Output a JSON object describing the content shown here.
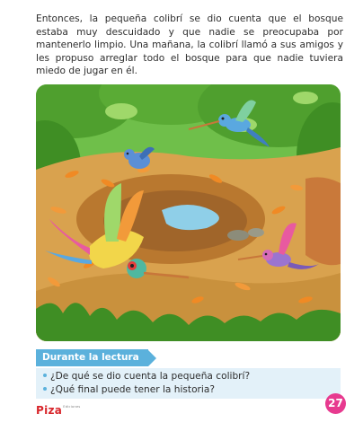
{
  "story": {
    "paragraph": "Entonces, la pequeña colibrí se dio cuenta que el bosque estaba muy descuidado y que nadie se preocupaba por mantenerlo limpio. Una mañana, la colibrí llamó a sus amigos y les propuso arreglar todo el bosque para que nadie tuviera miedo de jugar en él."
  },
  "illustration": {
    "palette": {
      "sky": "#6fbf4a",
      "foliage": "#4f9f2e",
      "dirt": "#d9a24e",
      "dirt_shadow": "#b9782f",
      "leaf": "#f08a24",
      "water": "#8fcfe8",
      "grass": "#3f8e24"
    }
  },
  "section": {
    "label": "Durante la lectura",
    "color": "#5bb1dc"
  },
  "questions": [
    "¿De qué se dio cuenta la pequeña colibrí?",
    "¿Qué final puede tener la historia?"
  ],
  "footer": {
    "page_number": "27",
    "page_number_color": "#e73a8f",
    "brand": "Piza",
    "brand_tag": "Ediciones",
    "brand_color": "#d8262b"
  }
}
